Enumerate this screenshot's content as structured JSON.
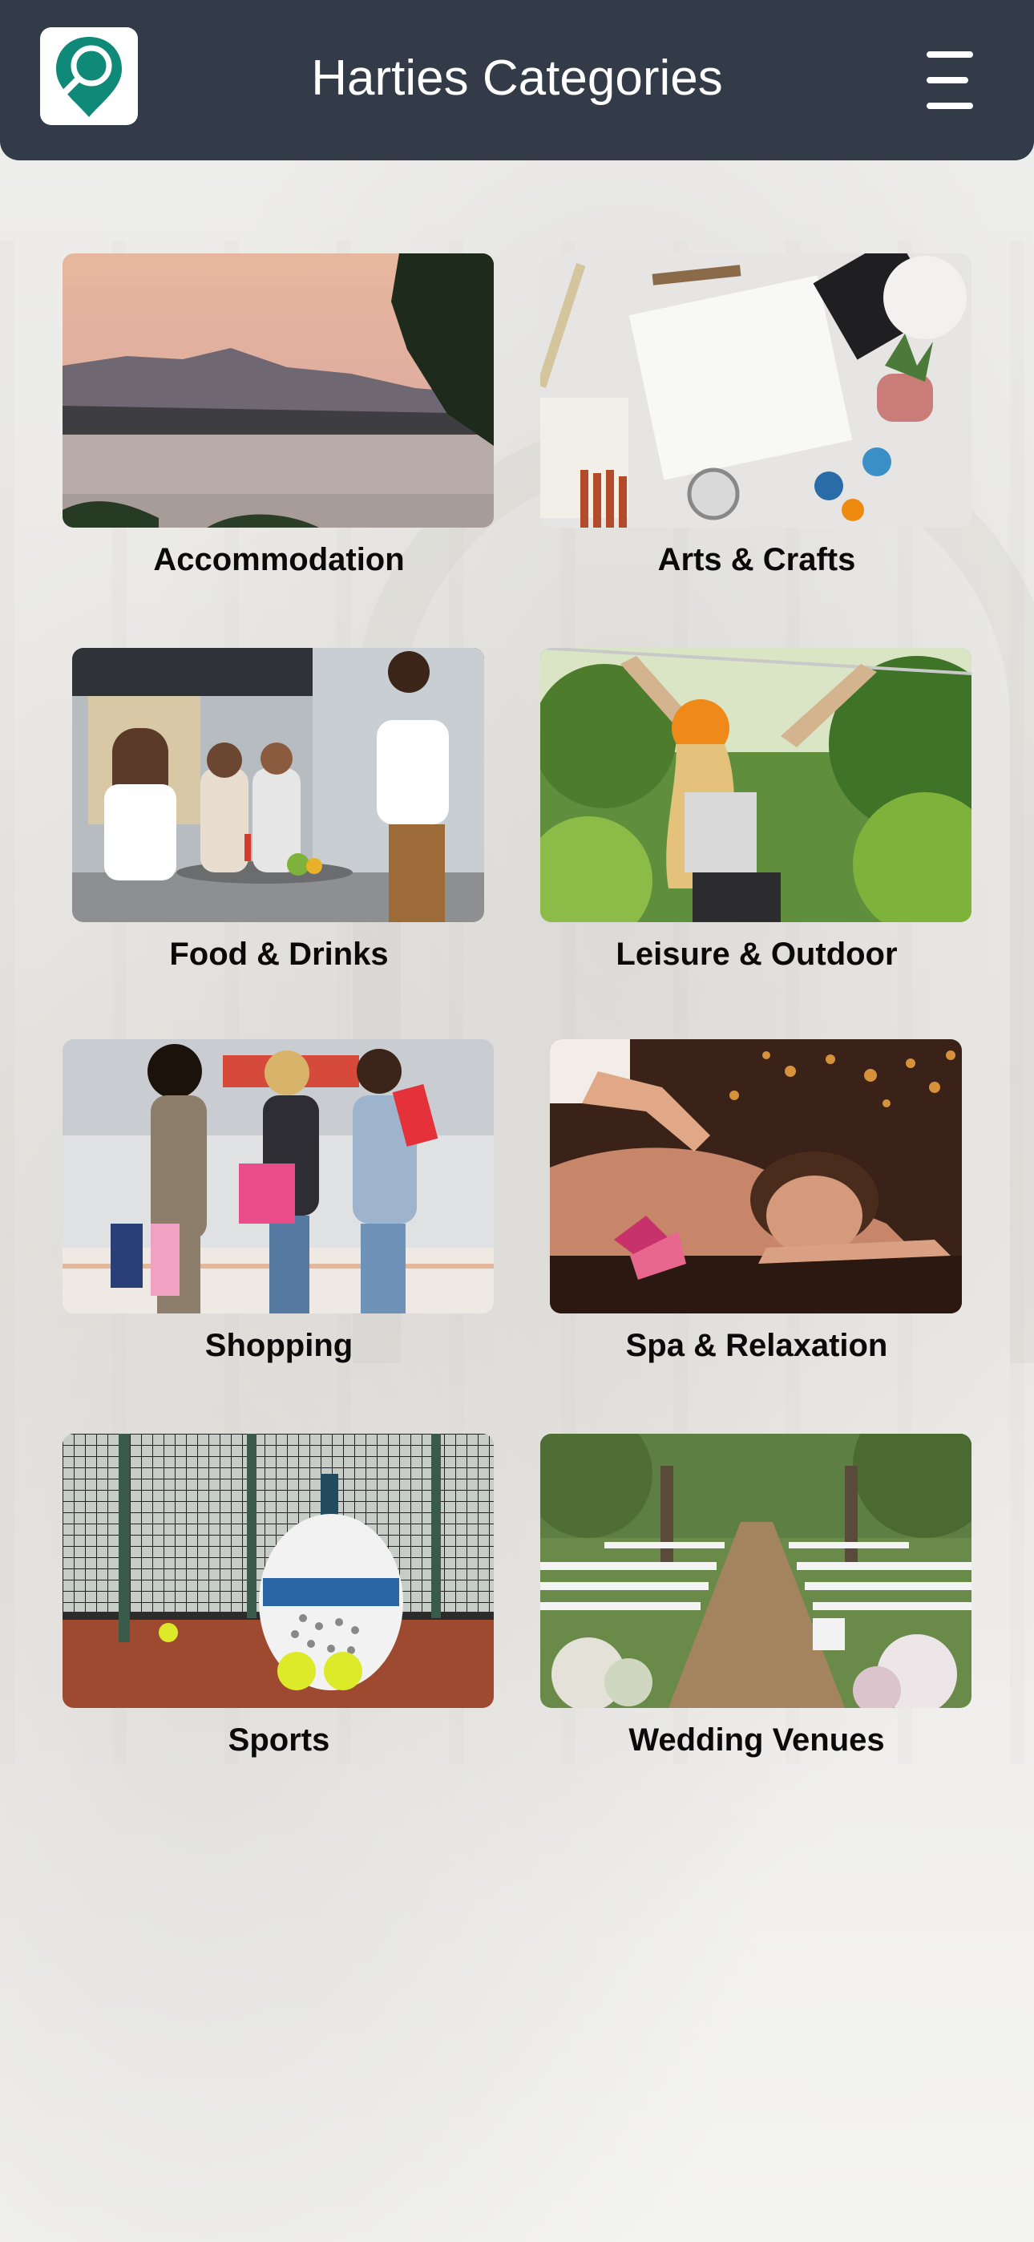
{
  "header": {
    "title": "Harties Categories",
    "logo_icon": "map-pin-search-icon",
    "menu_icon": "hamburger-menu-icon"
  },
  "colors": {
    "header_bg": "#323b47",
    "accent": "#0f8a78",
    "label_text": "#0a0a0a"
  },
  "categories": [
    {
      "label": "Accommodation",
      "image": "lake-sunset-mountains-photo"
    },
    {
      "label": "Arts & Crafts",
      "image": "art-supplies-flatlay-photo"
    },
    {
      "label": "Food & Drinks",
      "image": "friends-dining-outdoor-photo"
    },
    {
      "label": "Leisure & Outdoor",
      "image": "zipline-forest-photo"
    },
    {
      "label": "Shopping",
      "image": "women-shopping-mall-photo"
    },
    {
      "label": "Spa & Relaxation",
      "image": "massage-candles-photo"
    },
    {
      "label": "Sports",
      "image": "padel-racket-net-photo"
    },
    {
      "label": "Wedding Venues",
      "image": "wedding-ceremony-garden-photo"
    }
  ]
}
